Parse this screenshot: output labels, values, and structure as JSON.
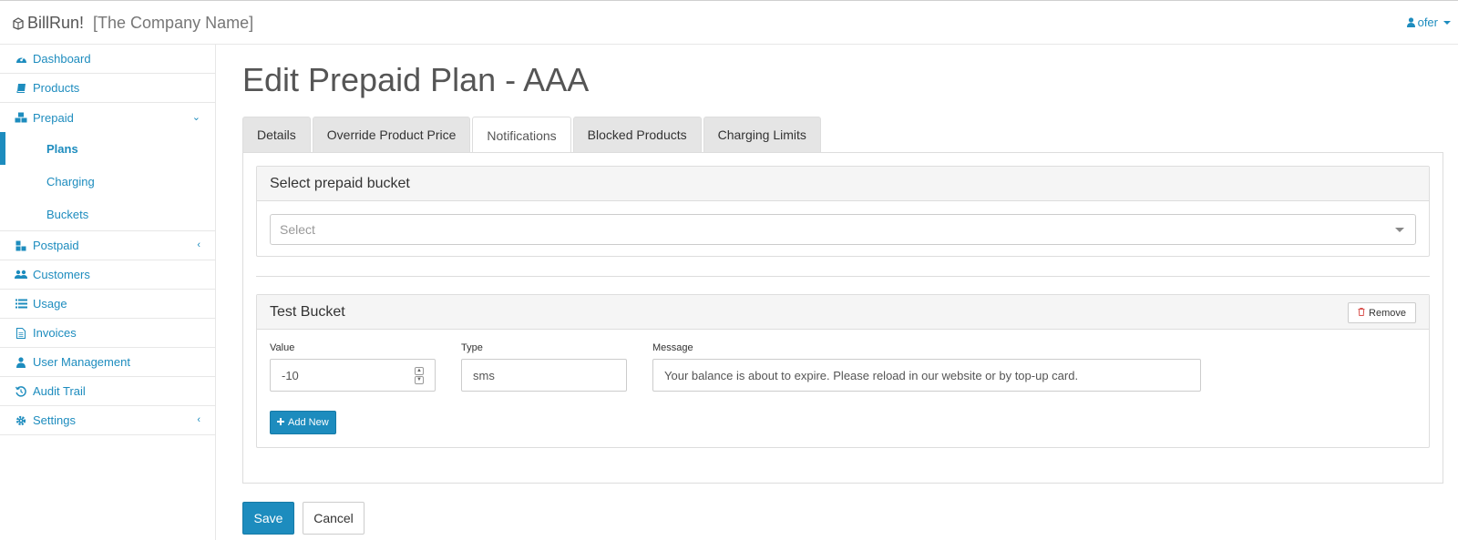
{
  "header": {
    "brand": "BillRun!",
    "company": "[The Company Name]",
    "user": "ofer"
  },
  "sidebar": {
    "items": [
      {
        "label": "Dashboard",
        "icon": "dashboard-icon"
      },
      {
        "label": "Products",
        "icon": "book-icon"
      },
      {
        "label": "Prepaid",
        "icon": "cubes-icon",
        "expanded": true
      },
      {
        "label": "Postpaid",
        "icon": "sitemap-icon"
      },
      {
        "label": "Customers",
        "icon": "users-icon"
      },
      {
        "label": "Usage",
        "icon": "list-icon"
      },
      {
        "label": "Invoices",
        "icon": "file-icon"
      },
      {
        "label": "User Management",
        "icon": "user-icon"
      },
      {
        "label": "Audit Trail",
        "icon": "history-icon"
      },
      {
        "label": "Settings",
        "icon": "gear-icon"
      }
    ],
    "prepaid_sub": [
      {
        "label": "Plans",
        "active": true
      },
      {
        "label": "Charging"
      },
      {
        "label": "Buckets"
      }
    ]
  },
  "main": {
    "title": "Edit Prepaid Plan - AAA",
    "tabs": [
      {
        "label": "Details"
      },
      {
        "label": "Override Product Price"
      },
      {
        "label": "Notifications",
        "active": true
      },
      {
        "label": "Blocked Products"
      },
      {
        "label": "Charging Limits"
      }
    ],
    "select_panel": {
      "title": "Select prepaid bucket",
      "placeholder": "Select"
    },
    "bucket_panel": {
      "title": "Test Bucket",
      "remove_label": "Remove",
      "value_label": "Value",
      "value": "-10",
      "type_label": "Type",
      "type": "sms",
      "message_label": "Message",
      "message": "Your balance is about to expire. Please reload in our website or by top-up card.",
      "add_label": "Add New"
    },
    "save_label": "Save",
    "cancel_label": "Cancel"
  },
  "colors": {
    "accent": "#1d8cbe",
    "danger": "#d9534f"
  }
}
